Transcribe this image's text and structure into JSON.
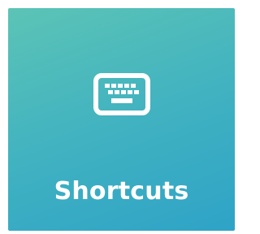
{
  "tile": {
    "label": "Shortcuts",
    "icon": "keyboard-icon",
    "colors": {
      "gradient_start": "#5cc4b6",
      "gradient_end": "#2fa3c7",
      "foreground": "#ffffff"
    }
  }
}
